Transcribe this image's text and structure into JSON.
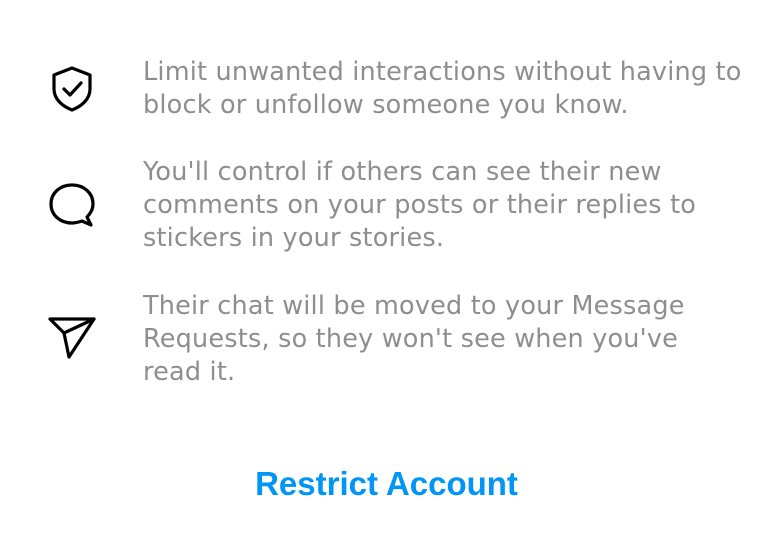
{
  "features": [
    {
      "icon": "shield-check-icon",
      "text": "Limit unwanted interactions without having to block or unfollow someone you know."
    },
    {
      "icon": "comment-bubble-icon",
      "text": "You'll control if others can see their new comments on your posts or their replies to stickers in your stories."
    },
    {
      "icon": "paper-plane-icon",
      "text": "Their chat will be moved to your Message Requests, so they won't see when you've read it."
    }
  ],
  "action": {
    "label": "Restrict Account",
    "color": "#0095f6"
  },
  "colors": {
    "body_text": "#8e8e8e",
    "icon_stroke": "#000000",
    "background": "#ffffff"
  }
}
